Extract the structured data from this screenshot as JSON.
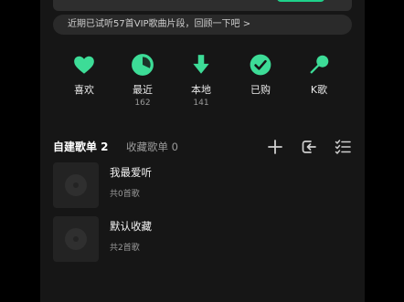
{
  "notice": "近期已试听57首VIP歌曲片段，回顾一下吧 >",
  "shortcuts": [
    {
      "label": "喜欢",
      "count": "",
      "icon": "heart-icon"
    },
    {
      "label": "最近",
      "count": "162",
      "icon": "clock-icon"
    },
    {
      "label": "本地",
      "count": "141",
      "icon": "download-icon"
    },
    {
      "label": "已购",
      "count": "",
      "icon": "check-circle-icon"
    },
    {
      "label": "K歌",
      "count": "",
      "icon": "microphone-icon"
    }
  ],
  "tabs": {
    "created": "自建歌单 2",
    "favorites": "收藏歌单 0"
  },
  "playlists": [
    {
      "title": "我最爱听",
      "subtitle": "共0首歌"
    },
    {
      "title": "默认收藏",
      "subtitle": "共2首歌"
    }
  ],
  "colors": {
    "accent": "#3ddc97",
    "background": "#161616"
  }
}
